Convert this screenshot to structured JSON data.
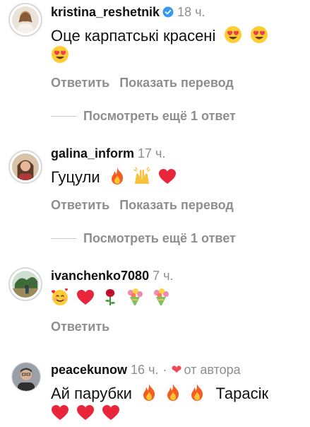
{
  "comments": [
    {
      "username": "kristina_reshetnik",
      "verified": true,
      "time": "18 ч.",
      "text_line1": "Оце карпатські красені",
      "emoji_line1": [
        "heart-eyes",
        "heart-eyes"
      ],
      "emoji_line2": [
        "heart-eyes"
      ],
      "reply_label": "Ответить",
      "translate_label": "Показать перевод",
      "view_more": "Посмотреть ещё 1 ответ"
    },
    {
      "username": "galina_inform",
      "time": "17 ч.",
      "text_line1": "Гуцули",
      "emoji_line1": [
        "fire",
        "raising-hands",
        "red-heart"
      ],
      "reply_label": "Ответить",
      "translate_label": "Показать перевод",
      "view_more": "Посмотреть ещё 1 ответ"
    },
    {
      "username": "ivanchenko7080",
      "time": "7 ч.",
      "emoji_line1": [
        "smiling-face-with-hearts",
        "red-heart",
        "rose",
        "bouquet",
        "bouquet"
      ],
      "reply_label": "Ответить"
    },
    {
      "username": "peacekunow",
      "time": "16 ч.",
      "separator": "·",
      "by_author": "от автора",
      "text_line1_part1": "Ай парубки",
      "text_line1_part2": "Тарасік",
      "emoji_line1": [
        "fire",
        "fire",
        "fire"
      ],
      "emoji_line2": [
        "red-heart",
        "red-heart",
        "red-heart"
      ]
    }
  ],
  "colors": {
    "text": "#111111",
    "secondary": "#8e8e8e",
    "verified": "#3897f0",
    "heart": "#ed4956"
  }
}
